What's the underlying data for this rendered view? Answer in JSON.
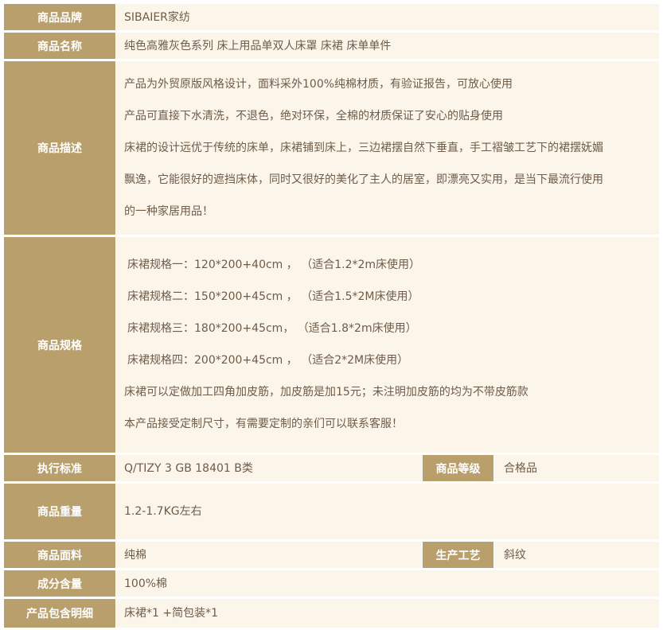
{
  "rows": {
    "brand": {
      "label": "商品品牌",
      "value": "SIBAIER家纺"
    },
    "name": {
      "label": "商品名称",
      "value": "纯色高雅灰色系列 床上用品单双人床罩 床裙 床单单件"
    },
    "desc": {
      "label": "商品描述",
      "lines": [
        "产品为外贸原版风格设计，面料采外100%纯棉材质，有验证报告，可放心使用",
        "产品可直接下水清洗，不退色，绝对环保，全棉的材质保证了安心的贴身使用",
        "床裙的设计远优于传统的床单，床裙铺到床上，三边裙摆自然下垂直，手工褶皱工艺下的裙摆妩媚",
        "飘逸，它能很好的遮挡床体，同时又很好的美化了主人的居室，即漂亮又实用，是当下最流行使用",
        "的一种家居用品！"
      ]
    },
    "spec": {
      "label": "商品规格",
      "lines": [
        "床裙规格一：120*200+40cm ，  （适合1.2*2m床使用）",
        "床裙规格二：150*200+45cm ，  （适合1.5*2M床使用）",
        "床裙规格三：180*200+45cm，   （适合1.8*2m床使用）",
        "床裙规格四：200*200+45cm  ，  （适合2*2M床使用）",
        "床裙可以定做加工四角加皮筋，加皮筋是加15元；未注明加皮筋的均为不带皮筋款",
        "本产品接受定制尺寸，有需要定制的亲们可以联系客服！"
      ]
    },
    "standard": {
      "label": "执行标准",
      "value": "Q/TIZY 3 GB 18401 B类"
    },
    "grade": {
      "label": "商品等级",
      "value": "合格品"
    },
    "weight": {
      "label": "商品重量",
      "value": "1.2-1.7KG左右"
    },
    "fabric": {
      "label": "商品面料",
      "value": "纯棉"
    },
    "craft": {
      "label": "生产工艺",
      "value": "斜纹"
    },
    "content": {
      "label": "成分含量",
      "value": "100%棉"
    },
    "package": {
      "label": "产品包含明细",
      "value": "床裙*1 +简包装*1"
    }
  },
  "colors": {
    "label_bg": "#b89f6b",
    "value_bg": "#fcf5ea",
    "text": "#6e5c48"
  }
}
